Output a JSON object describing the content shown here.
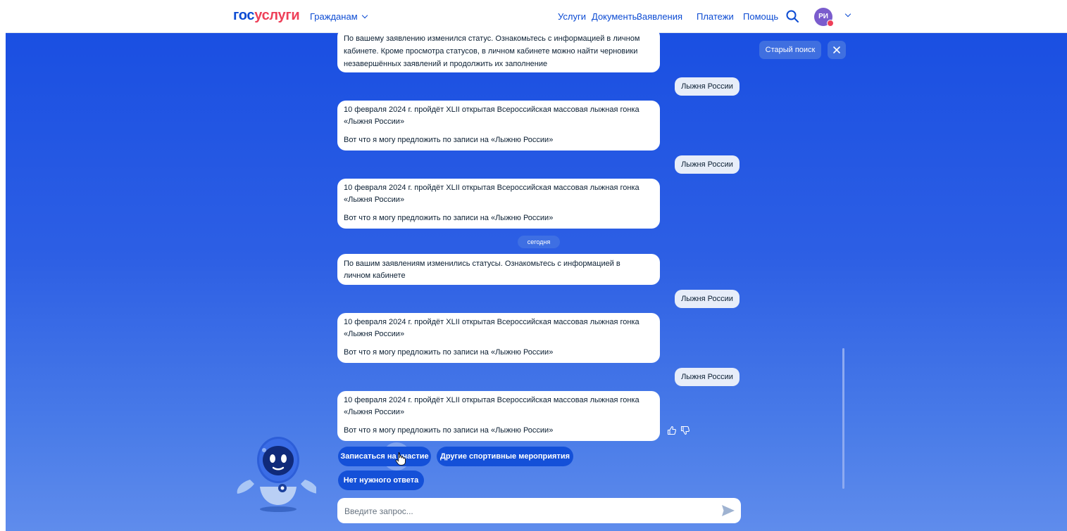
{
  "header": {
    "logo_part1": "гос",
    "logo_part2": "услуги",
    "audience": "Гражданам",
    "nav": [
      "Услуги",
      "Документы",
      "Заявления",
      "Платежи",
      "Помощь"
    ],
    "avatar_initials": "РИ"
  },
  "toolbar": {
    "old_search_label": "Старый поиск"
  },
  "chat": {
    "messages": [
      {
        "lines": [
          "По вашему заявлению изменился статус. Ознакомьтесь с информацией в личном",
          "кабинете. Кроме просмотра статусов, в личном кабинете можно найти черновики",
          "незавершённых заявлений и продолжить их заполнение"
        ]
      },
      {
        "user": "Лыжня России"
      },
      {
        "lines": [
          "10 февраля 2024 г. пройдёт XLII открытая Всероссийская массовая лыжная гонка",
          "«Лыжня России»",
          "Вот что я могу предложить по записи на «Лыжню России»"
        ]
      },
      {
        "user": "Лыжня России"
      },
      {
        "lines": [
          "10 февраля 2024 г. пройдёт XLII открытая Всероссийская массовая лыжная гонка",
          "«Лыжня России»",
          "Вот что я могу предложить по записи на «Лыжню России»"
        ]
      },
      {
        "date": "сегодня"
      },
      {
        "lines": [
          "По вашим заявлениям изменились статусы. Ознакомьтесь с информацией в",
          "личном кабинете"
        ]
      },
      {
        "user": "Лыжня России"
      },
      {
        "lines": [
          "10 февраля 2024 г. пройдёт XLII открытая Всероссийская массовая лыжная гонка",
          "«Лыжня России»",
          "Вот что я могу предложить по записи на «Лыжню России»"
        ]
      },
      {
        "user": "Лыжня России"
      },
      {
        "lines": [
          "10 февраля 2024 г. пройдёт XLII открытая Всероссийская массовая лыжная гонка",
          "«Лыжня России»",
          "Вот что я могу предложить по записи на «Лыжню России»"
        ]
      }
    ],
    "quick_replies": [
      "Записаться на участие",
      "Другие спортивные мероприятия",
      "Нет нужного ответа"
    ],
    "input_placeholder": "Введите запрос..."
  },
  "colors": {
    "brand_blue": "#0d4cd3",
    "brand_red": "#ee3f58",
    "chip_blue": "#1450d8",
    "user_bubble": "#e7edf9"
  },
  "icons": [
    "chevron-down-icon",
    "search-icon",
    "close-icon",
    "thumbs-up-icon",
    "thumbs-down-icon",
    "send-icon",
    "robot-mascot",
    "hand-cursor-icon"
  ]
}
